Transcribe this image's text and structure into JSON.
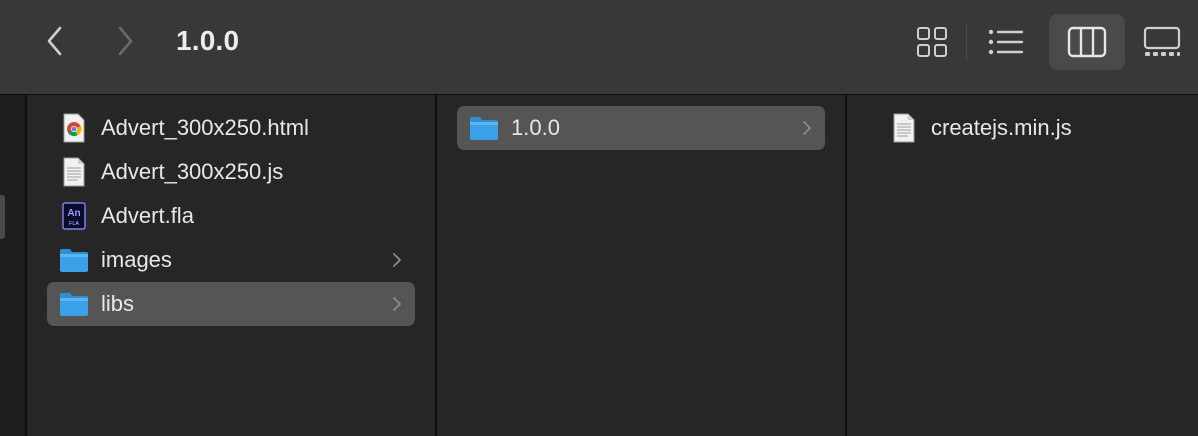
{
  "window": {
    "title": "1.0.0"
  },
  "toolbar": {
    "back_icon": "chevron-left-icon",
    "forward_icon": "chevron-right-icon",
    "views": [
      {
        "name": "icon-view",
        "icon": "grid-icon"
      },
      {
        "name": "list-view",
        "icon": "list-icon"
      },
      {
        "name": "column-view",
        "icon": "columns-icon",
        "selected": true
      },
      {
        "name": "gallery-view",
        "icon": "gallery-icon"
      }
    ]
  },
  "columns": [
    {
      "items": [
        {
          "name": "Advert_300x250.html",
          "icon": "chrome-html-icon"
        },
        {
          "name": "Advert_300x250.js",
          "icon": "js-file-icon"
        },
        {
          "name": "Advert.fla",
          "icon": "animate-fla-icon",
          "badge_top": "An",
          "badge_bottom": "FLA"
        },
        {
          "name": "images",
          "icon": "folder-icon",
          "has_children": true
        },
        {
          "name": "libs",
          "icon": "folder-icon",
          "has_children": true,
          "selected": true
        }
      ]
    },
    {
      "items": [
        {
          "name": "1.0.0",
          "icon": "folder-icon",
          "has_children": true,
          "selected": true
        }
      ]
    },
    {
      "items": [
        {
          "name": "createjs.min.js",
          "icon": "js-file-icon"
        }
      ]
    }
  ],
  "colors": {
    "toolbar": "#383838",
    "background": "#262626",
    "selection": "#555555",
    "folder": "#3aa1e8"
  }
}
